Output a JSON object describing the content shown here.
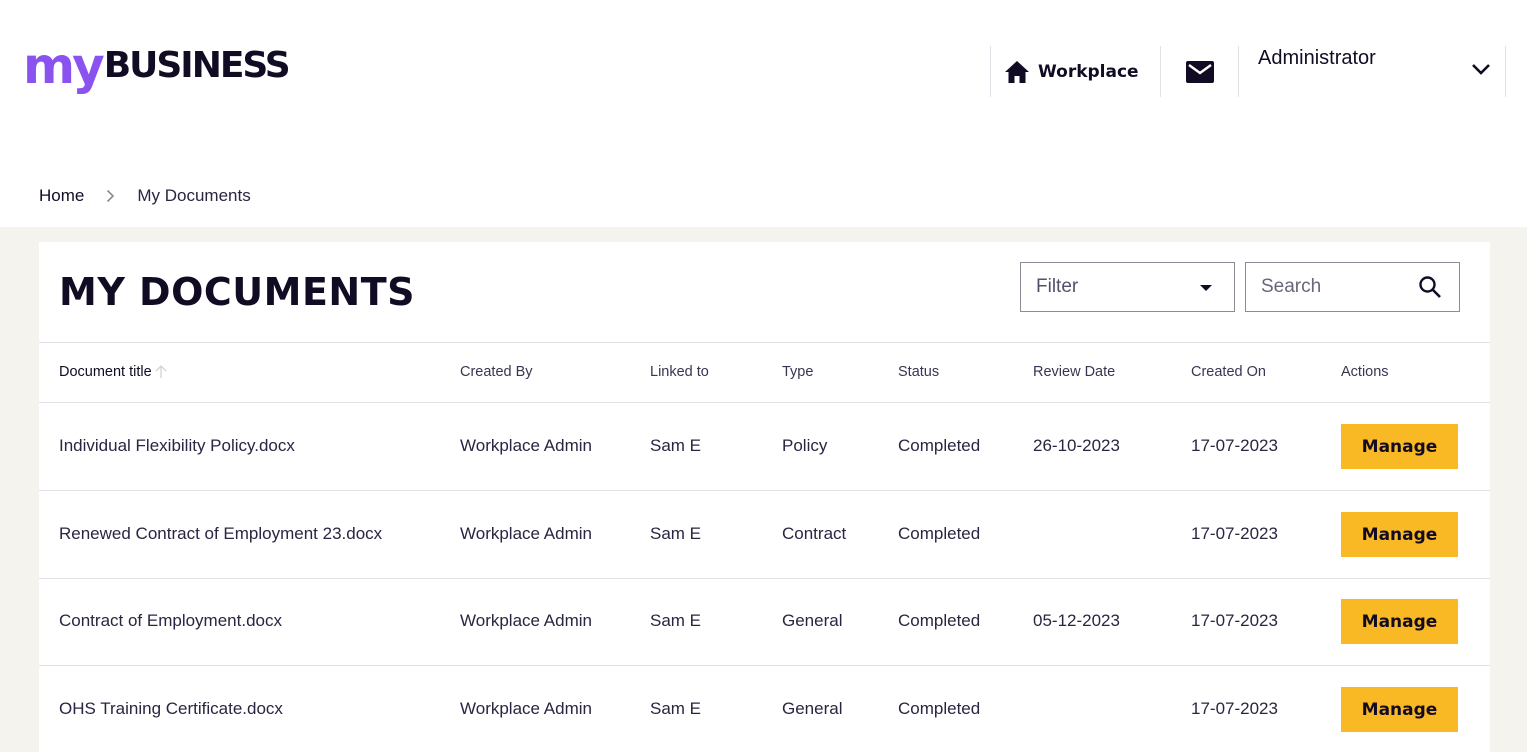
{
  "brand": {
    "prefix": "my",
    "name": "BUSINESS",
    "accent": "#8a52ef",
    "button_color": "#f9b924"
  },
  "nav": {
    "workplace_label": "Workplace",
    "home_icon": "home-icon",
    "mail_icon": "mail-icon",
    "user_name": "Administrator",
    "dropdown_icon": "chevron-down-icon"
  },
  "breadcrumb": {
    "home": "Home",
    "current": "My Documents"
  },
  "page": {
    "title": "MY DOCUMENTS"
  },
  "filter": {
    "label": "Filter"
  },
  "search": {
    "placeholder": "Search"
  },
  "table": {
    "columns": [
      "Document title",
      "Created By",
      "Linked to",
      "Type",
      "Status",
      "Review Date",
      "Created On",
      "Actions"
    ],
    "sort_icon": "arrow-up-icon",
    "rows": [
      {
        "title": "Individual Flexibility Policy.docx",
        "created_by": "Workplace Admin",
        "linked_to": "Sam E",
        "type": "Policy",
        "status": "Completed",
        "review_date": "26-10-2023",
        "created_on": "17-07-2023",
        "action": "Manage"
      },
      {
        "title": "Renewed Contract of Employment 23.docx",
        "created_by": "Workplace Admin",
        "linked_to": "Sam E",
        "type": "Contract",
        "status": "Completed",
        "review_date": "",
        "created_on": "17-07-2023",
        "action": "Manage"
      },
      {
        "title": "Contract of Employment.docx",
        "created_by": "Workplace Admin",
        "linked_to": "Sam E",
        "type": "General",
        "status": "Completed",
        "review_date": "05-12-2023",
        "created_on": "17-07-2023",
        "action": "Manage"
      },
      {
        "title": "OHS Training Certificate.docx",
        "created_by": "Workplace Admin",
        "linked_to": "Sam E",
        "type": "General",
        "status": "Completed",
        "review_date": "",
        "created_on": "17-07-2023",
        "action": "Manage"
      }
    ]
  }
}
